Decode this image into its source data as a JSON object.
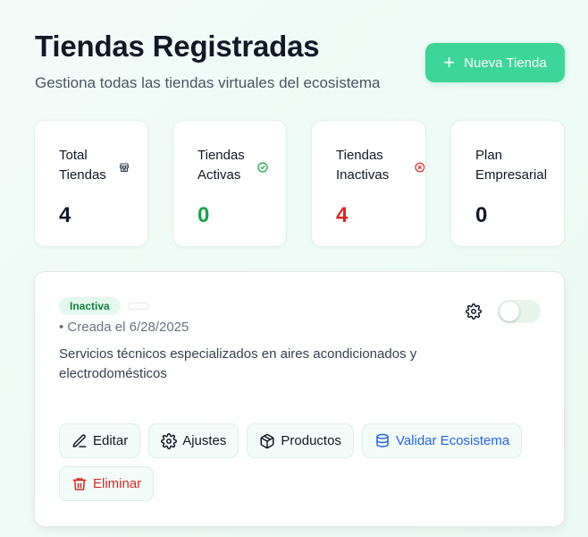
{
  "header": {
    "title": "Tiendas Registradas",
    "subtitle": "Gestiona todas las tiendas virtuales del ecosistema",
    "new_button": {
      "icon": "plus-icon",
      "label": "Nueva Tienda"
    }
  },
  "stats": [
    {
      "label": "Total Tiendas",
      "value": "4",
      "icon": "store-icon",
      "color": "#111827"
    },
    {
      "label": "Tiendas Activas",
      "value": "0",
      "icon": "check-circle-icon",
      "color": "#16a34a"
    },
    {
      "label": "Tiendas Inactivas",
      "value": "4",
      "icon": "x-circle-icon",
      "color": "#dc2626"
    },
    {
      "label": "Plan Empresarial",
      "value": "0",
      "icon": "",
      "color": "#111827"
    }
  ],
  "store_card": {
    "status_badge": "Inactiva",
    "created": "• Creada el 6/28/2025",
    "description": "Servicios técnicos especializados en aires acondicionados y electrodomésticos",
    "toggle_on": false,
    "actions": [
      {
        "label": "Editar",
        "icon": "pencil-icon"
      },
      {
        "label": "Ajustes",
        "icon": "gear-icon"
      },
      {
        "label": "Productos",
        "icon": "box-icon"
      },
      {
        "label": "Validar Ecosistema",
        "icon": "database-icon",
        "color": "#2563eb"
      },
      {
        "label": "Eliminar",
        "icon": "trash-icon",
        "color": "#dc2626"
      }
    ]
  }
}
